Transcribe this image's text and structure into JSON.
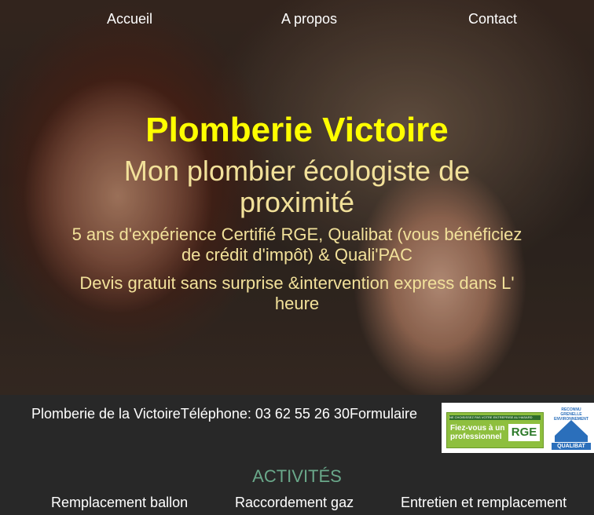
{
  "nav": {
    "home": "Accueil",
    "about": "A propos",
    "contact": "Contact"
  },
  "hero": {
    "title": "Plomberie Victoire",
    "subtitle": "Mon plombier écologiste de proximité",
    "experience": "5 ans d'expérience Certifié RGE, Qualibat (vous bénéficiez de crédit d'impôt) & Quali'PAC",
    "quote": "Devis gratuit sans surprise &intervention express dans L' heure"
  },
  "footer_bar": {
    "company": "Plomberie de la Victoire",
    "phone": "Téléphone: 03 62 55 26 30",
    "form": "Formulaire",
    "badges": {
      "rge_top": "NE CHOISISSEZ PAS VOTRE ENTREPRISE AU HASARD",
      "rge_text": "Fiez-vous à un professionnel",
      "rge_logo": "RGE",
      "qualibat_top": "RECONNU GRENELLE ENVIRONNEMENT",
      "qualibat_label": "QUALIBAT"
    }
  },
  "activities": {
    "heading": "ACTIVITÉS",
    "items": [
      "Remplacement ballon",
      "Raccordement gaz",
      "Entretien et remplacement"
    ]
  },
  "colors": {
    "title": "#ffff00",
    "subtitle": "#f2e19a",
    "activities_heading": "#6aa88a",
    "bar_bg": "#282828"
  }
}
